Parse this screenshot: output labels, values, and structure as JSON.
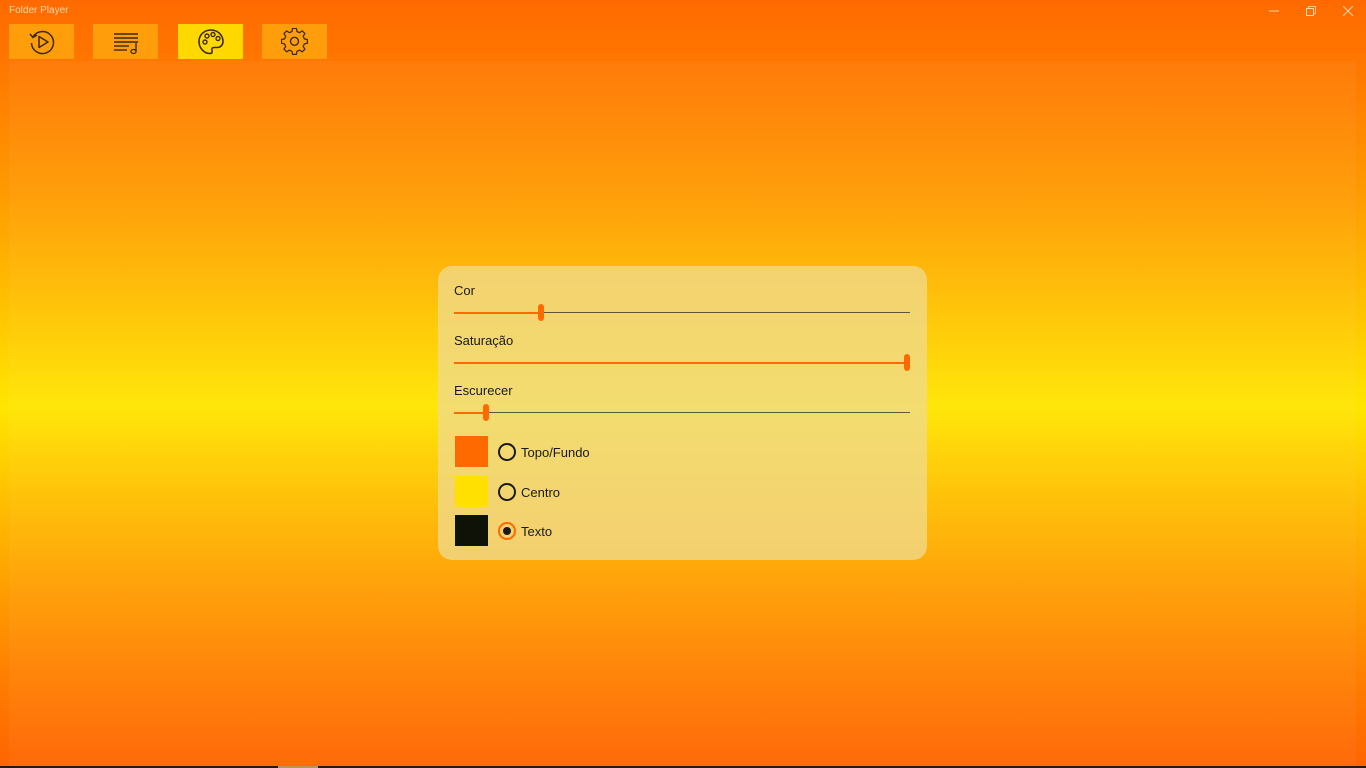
{
  "app": {
    "title": "Folder Player"
  },
  "window_controls": [
    {
      "name": "minimize-icon",
      "glyph": "—"
    },
    {
      "name": "restore-icon",
      "glyph": "❐"
    },
    {
      "name": "close-icon",
      "glyph": "✕"
    }
  ],
  "toolbar": {
    "buttons": [
      {
        "name": "now-playing",
        "icon": "replay-play-icon",
        "active": false
      },
      {
        "name": "playlist",
        "icon": "playlist-icon",
        "active": false
      },
      {
        "name": "theme",
        "icon": "palette-icon",
        "active": true
      },
      {
        "name": "settings",
        "icon": "gear-icon",
        "active": false
      }
    ]
  },
  "panel": {
    "sliders": [
      {
        "label": "Cor",
        "value": 0.19
      },
      {
        "label": "Saturação",
        "value": 1.0
      },
      {
        "label": "Escurecer",
        "value": 0.07
      }
    ],
    "color_options": [
      {
        "label": "Topo/Fundo",
        "color": "#ff6a00",
        "checked": false
      },
      {
        "label": "Centro",
        "color": "#ffe000",
        "checked": false
      },
      {
        "label": "Texto",
        "color": "#0f1206",
        "checked": true
      }
    ]
  },
  "colors": {
    "accent": "#ff6a00",
    "active_tab": "#ffd800",
    "tab": "#ff9d0a"
  }
}
